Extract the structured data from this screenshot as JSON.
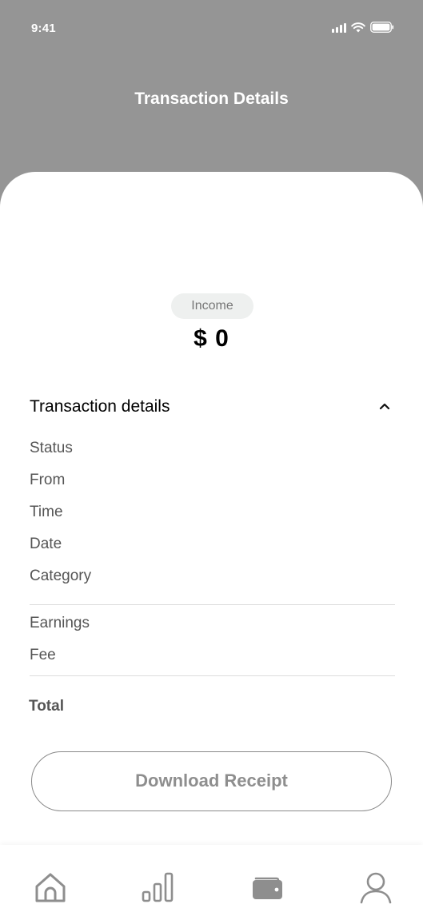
{
  "status_bar": {
    "time": "9:41"
  },
  "header": {
    "title": "Transaction Details"
  },
  "transaction": {
    "type": "Income",
    "amount": "$ 0"
  },
  "details": {
    "section_title": "Transaction details",
    "fields": [
      "Status",
      "From",
      "Time",
      "Date",
      "Category"
    ],
    "amounts": [
      "Earnings",
      "Fee"
    ],
    "total_label": "Total"
  },
  "actions": {
    "download_label": "Download Receipt"
  },
  "bottom_nav": {
    "items": [
      {
        "icon": "home-icon"
      },
      {
        "icon": "bar-chart-icon"
      },
      {
        "icon": "wallet-icon",
        "active": true
      },
      {
        "icon": "profile-icon"
      }
    ]
  }
}
